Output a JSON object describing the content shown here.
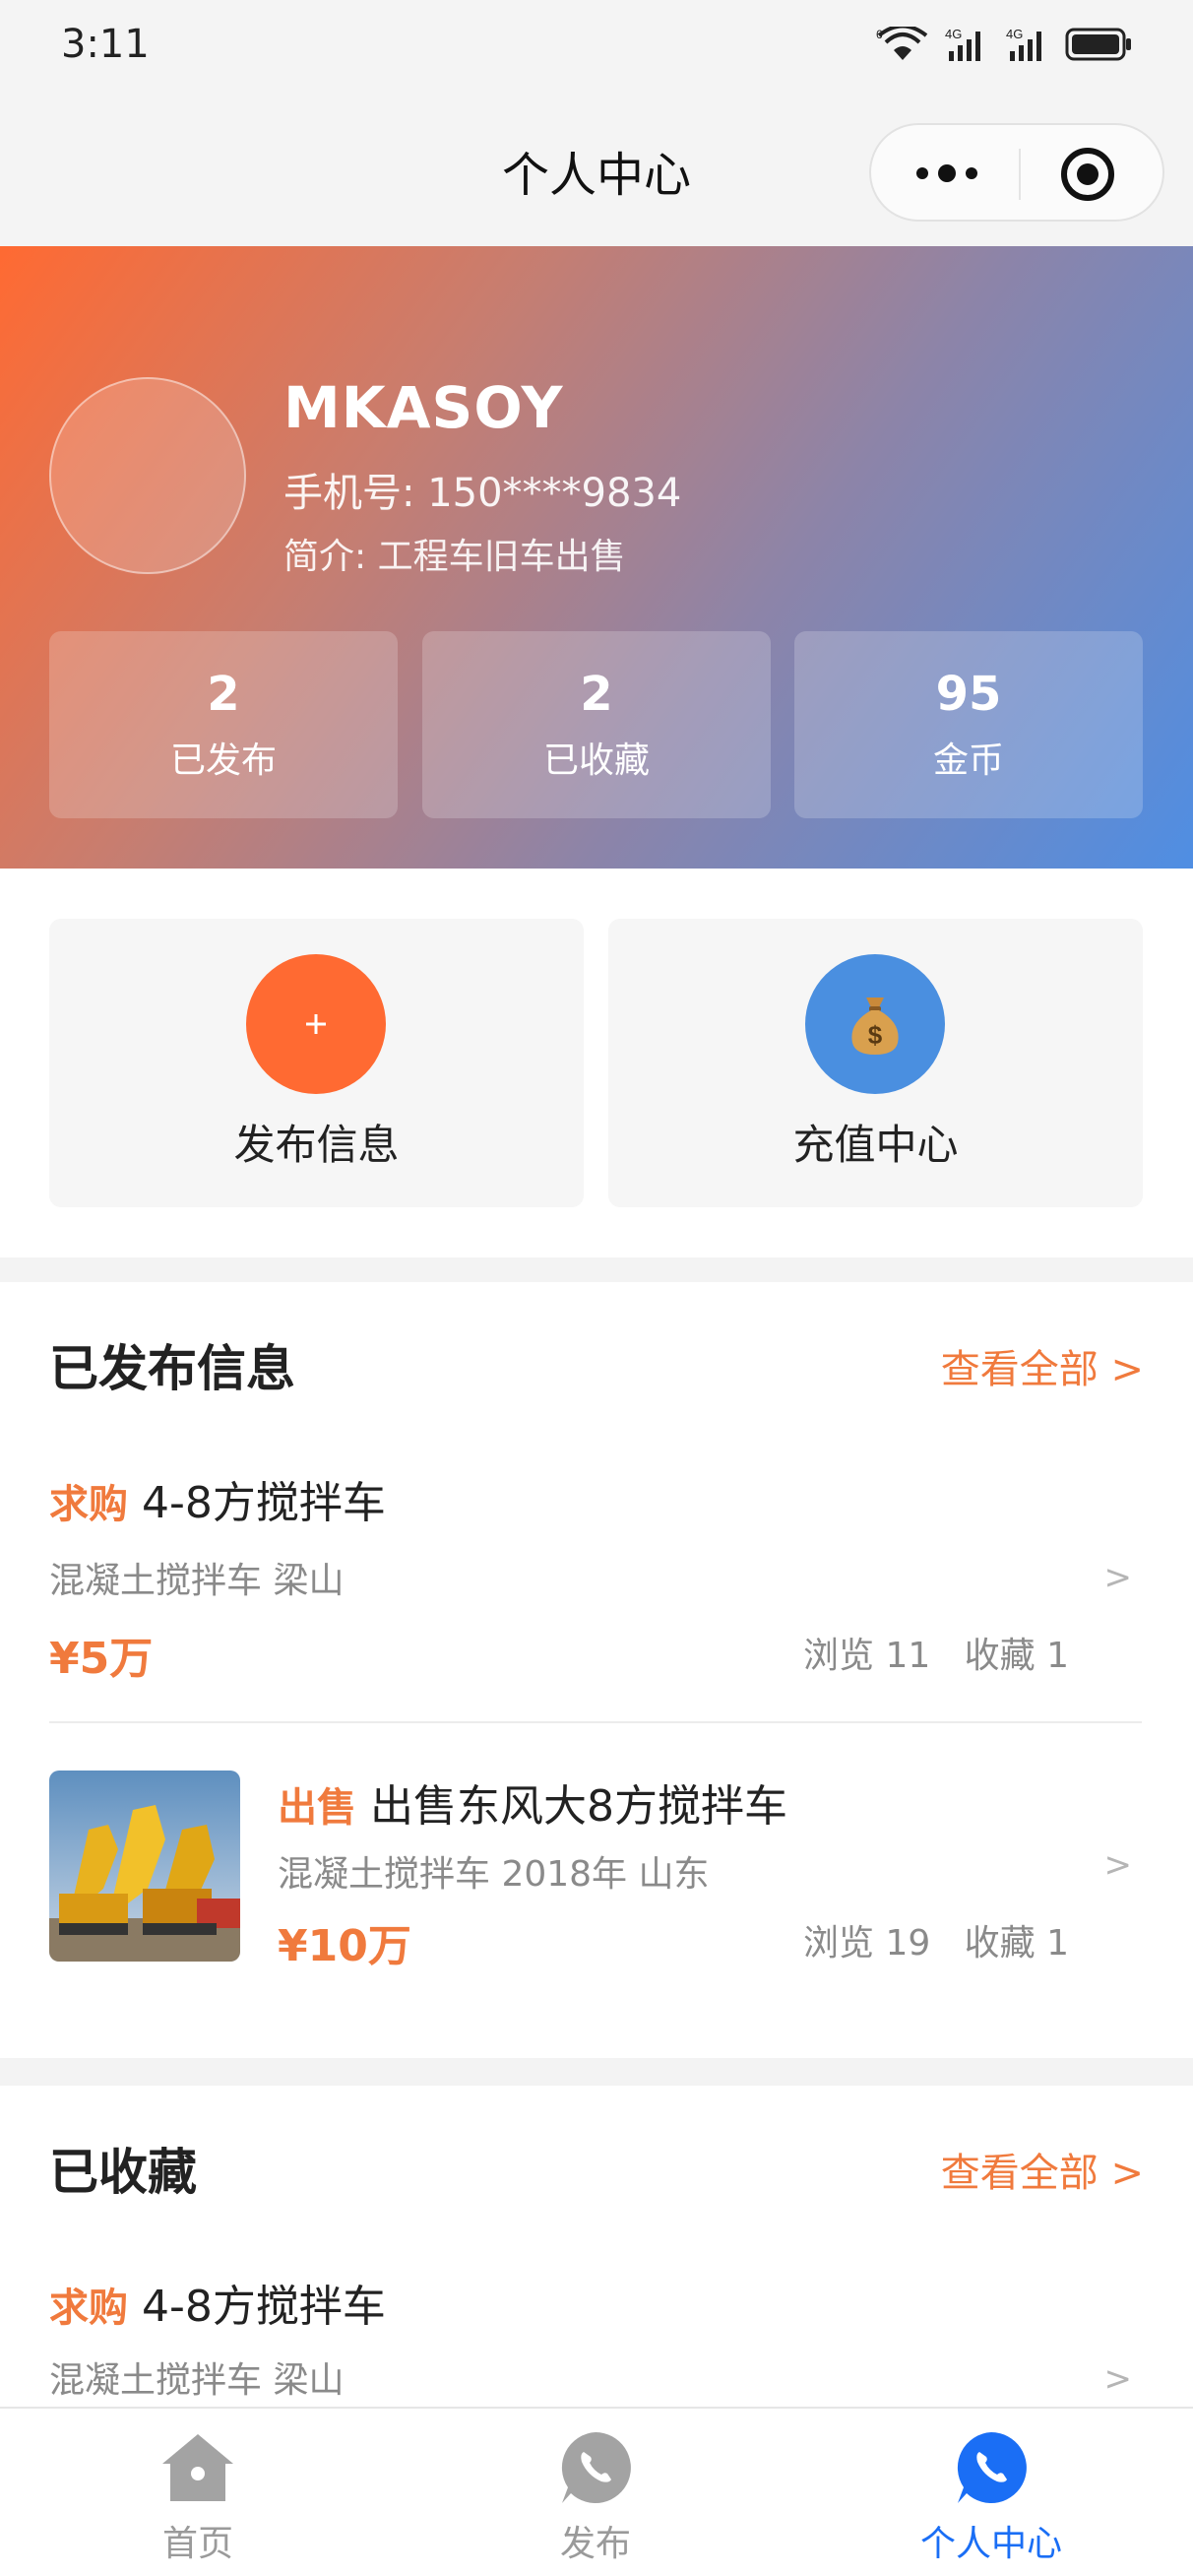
{
  "status_bar": {
    "time": "3:11",
    "signal_label_1": "4G",
    "signal_label_2": "4G",
    "wifi_badge": "6"
  },
  "nav": {
    "title": "个人中心"
  },
  "profile": {
    "username": "MKASOY",
    "phone": "手机号: 150****9834",
    "bio": "简介: 工程车旧车出售",
    "stats": [
      {
        "value": "2",
        "label": "已发布"
      },
      {
        "value": "2",
        "label": "已收藏"
      },
      {
        "value": "95",
        "label": "金币"
      }
    ]
  },
  "quick_actions": [
    {
      "label": "发布信息",
      "icon": "plus-icon",
      "color": "#ff6a32"
    },
    {
      "label": "充值中心",
      "icon": "money-bag-icon",
      "color": "#4a8fe0"
    }
  ],
  "published": {
    "title": "已发布信息",
    "more": "查看全部 >",
    "items": [
      {
        "tag": "求购",
        "title": "4-8方搅拌车",
        "meta": "混凝土搅拌车 梁山",
        "price": "¥5万",
        "views": "浏览 11",
        "favs": "收藏 1",
        "chevron": ">"
      },
      {
        "tag": "出售",
        "title": "出售东风大8方搅拌车",
        "meta": "混凝土搅拌车 2018年 山东",
        "price": "¥10万",
        "views": "浏览 19",
        "favs": "收藏 1",
        "chevron": ">"
      }
    ]
  },
  "favorites": {
    "title": "已收藏",
    "more": "查看全部 >",
    "items": [
      {
        "tag": "求购",
        "title": "4-8方搅拌车",
        "meta": "混凝土搅拌车 梁山",
        "chevron": ">"
      }
    ]
  },
  "tabbar": [
    {
      "label": "首页",
      "icon": "home-icon",
      "active": false
    },
    {
      "label": "发布",
      "icon": "phone-icon",
      "active": false
    },
    {
      "label": "个人中心",
      "icon": "phone-icon",
      "active": true
    }
  ],
  "colors": {
    "accent": "#f07a3d",
    "active_tab": "#1a6ef5",
    "inactive_tab": "#9a9a9a"
  }
}
